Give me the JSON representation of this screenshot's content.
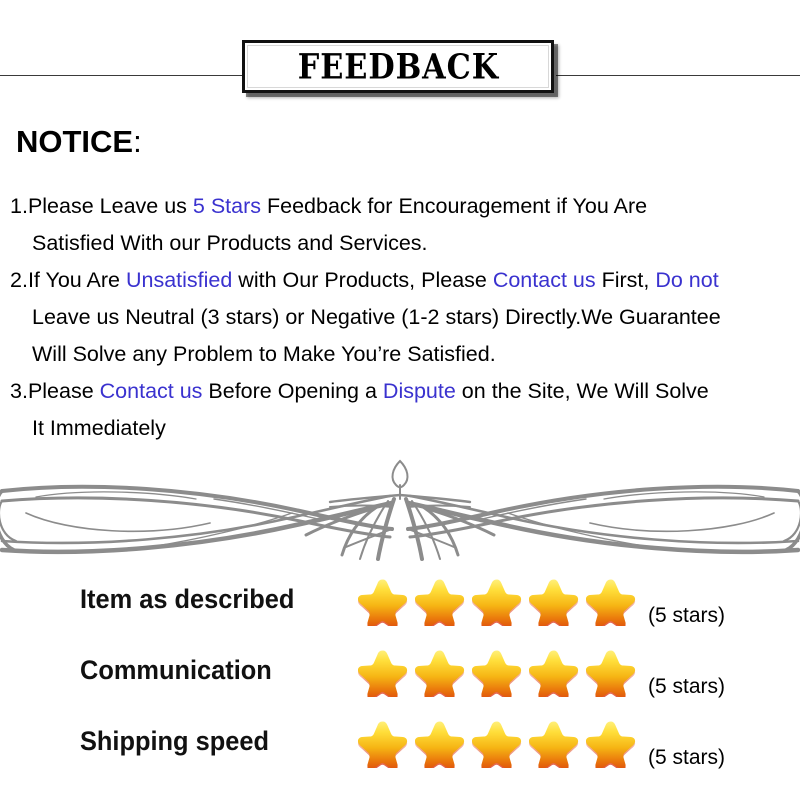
{
  "header": {
    "title": "FEEDBACK"
  },
  "notice": {
    "heading": "NOTICE",
    "heading_colon": ":",
    "items": [
      {
        "number": "1.",
        "lines": [
          [
            {
              "text": "Please Leave us ",
              "color": "black"
            },
            {
              "text": " 5 Stars ",
              "color": "blue"
            },
            {
              "text": " Feedback for  Encouragement  if You Are",
              "color": "black"
            }
          ],
          [
            {
              "text": "Satisfied With our Products and Services.",
              "color": "black"
            }
          ]
        ]
      },
      {
        "number": "2.",
        "lines": [
          [
            {
              "text": "If You Are ",
              "color": "black"
            },
            {
              "text": "Unsatisfied",
              "color": "blue"
            },
            {
              "text": " with Our Products, Please ",
              "color": "black"
            },
            {
              "text": "Contact us",
              "color": "blue"
            },
            {
              "text": " First, ",
              "color": "black"
            },
            {
              "text": "Do not",
              "color": "blue"
            }
          ],
          [
            {
              "text": "Leave us Neutral (3 stars) or Negative (1-2 stars) Directly.We Guarantee",
              "color": "black"
            }
          ],
          [
            {
              "text": "Will Solve any Problem to Make You’re  Satisfied.",
              "color": "black"
            }
          ]
        ]
      },
      {
        "number": "3.",
        "lines": [
          [
            {
              "text": "Please ",
              "color": "black"
            },
            {
              "text": "Contact us",
              "color": "blue"
            },
            {
              "text": " Before Opening a ",
              "color": "black"
            },
            {
              "text": "Dispute",
              "color": "blue"
            },
            {
              "text": " on the Site, We Will Solve",
              "color": "black"
            }
          ],
          [
            {
              "text": "It Immediately",
              "color": "black"
            }
          ]
        ]
      }
    ]
  },
  "ratings": {
    "rows": [
      {
        "label": "Item as described",
        "stars": 5,
        "caption": "(5 stars)"
      },
      {
        "label": "Communication",
        "stars": 5,
        "caption": "(5 stars)"
      },
      {
        "label": "Shipping speed",
        "stars": 5,
        "caption": "(5 stars)"
      }
    ]
  },
  "colors": {
    "highlight_blue": "#3a32cf",
    "text_black": "#000000",
    "ornament_gray": "#8c8c8c",
    "star_top": "#ffe84a",
    "star_mid": "#f5b915",
    "star_bottom": "#e2640d",
    "star_shadow": "#d8321a"
  }
}
